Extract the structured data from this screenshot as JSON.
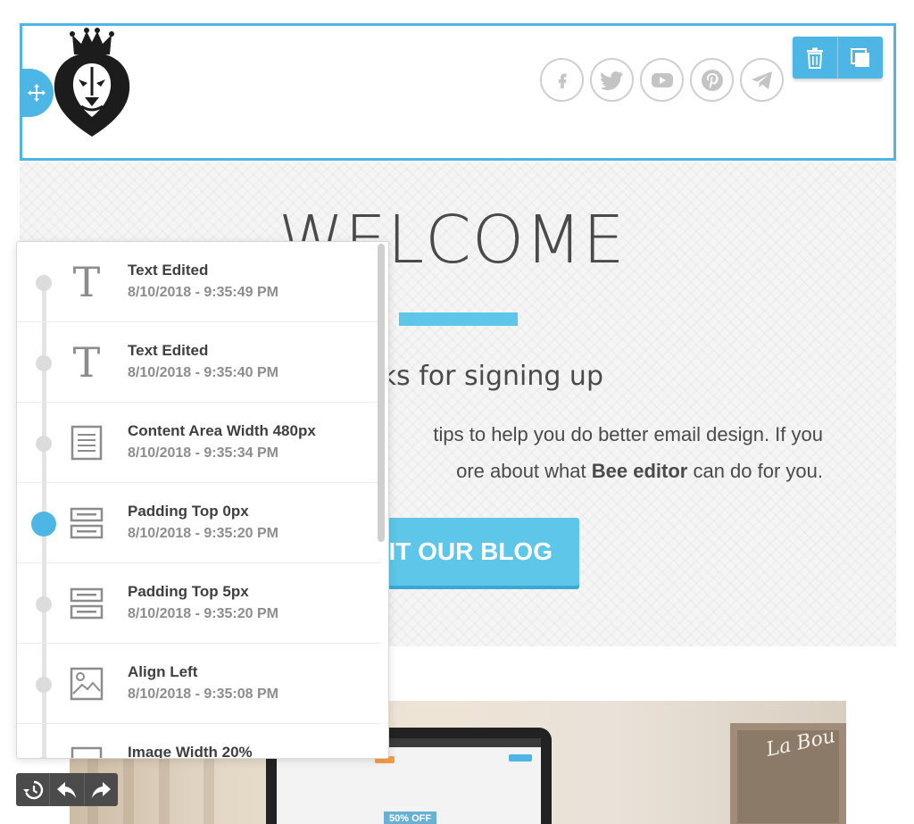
{
  "header": {
    "social": [
      {
        "icon": "facebook-icon"
      },
      {
        "icon": "twitter-icon"
      },
      {
        "icon": "youtube-icon"
      },
      {
        "icon": "pinterest-icon"
      },
      {
        "icon": "telegram-icon"
      }
    ],
    "actions": [
      "delete-icon",
      "duplicate-icon"
    ]
  },
  "hero": {
    "title": "WELCOME",
    "subheading": "ks for signing up",
    "body_line1": "tips to help you do better email design. If you",
    "body_line2_prefix": "ore about what ",
    "body_line2_bold": "Bee editor",
    "body_line2_suffix": " can do for you.",
    "cta": "SIT OUR BLOG"
  },
  "image": {
    "screen_offer": "50% OFF",
    "script_text": "La Bou"
  },
  "history": {
    "items": [
      {
        "title": "Text Edited",
        "time": "8/10/2018 - 9:35:49 PM",
        "icon": "text-icon"
      },
      {
        "title": "Text Edited",
        "time": "8/10/2018 - 9:35:40 PM",
        "icon": "text-icon"
      },
      {
        "title": "Content Area Width 480px",
        "time": "8/10/2018 - 9:35:34 PM",
        "icon": "document-icon"
      },
      {
        "title": "Padding Top 0px",
        "time": "8/10/2018 - 9:35:20 PM",
        "icon": "padding-icon"
      },
      {
        "title": "Padding Top 5px",
        "time": "8/10/2018 - 9:35:20 PM",
        "icon": "padding-icon"
      },
      {
        "title": "Align Left",
        "time": "8/10/2018 - 9:35:08 PM",
        "icon": "image-icon"
      },
      {
        "title": "Image Width 20%",
        "time": "",
        "icon": "document-icon"
      }
    ],
    "active_index": 3
  },
  "toolbar": [
    "history-icon",
    "undo-icon",
    "redo-icon"
  ],
  "colors": {
    "accent": "#4db6e4",
    "cta": "#5ec6e8",
    "text_dark": "#4a4a4a",
    "text_muted": "#8d8d8d"
  }
}
